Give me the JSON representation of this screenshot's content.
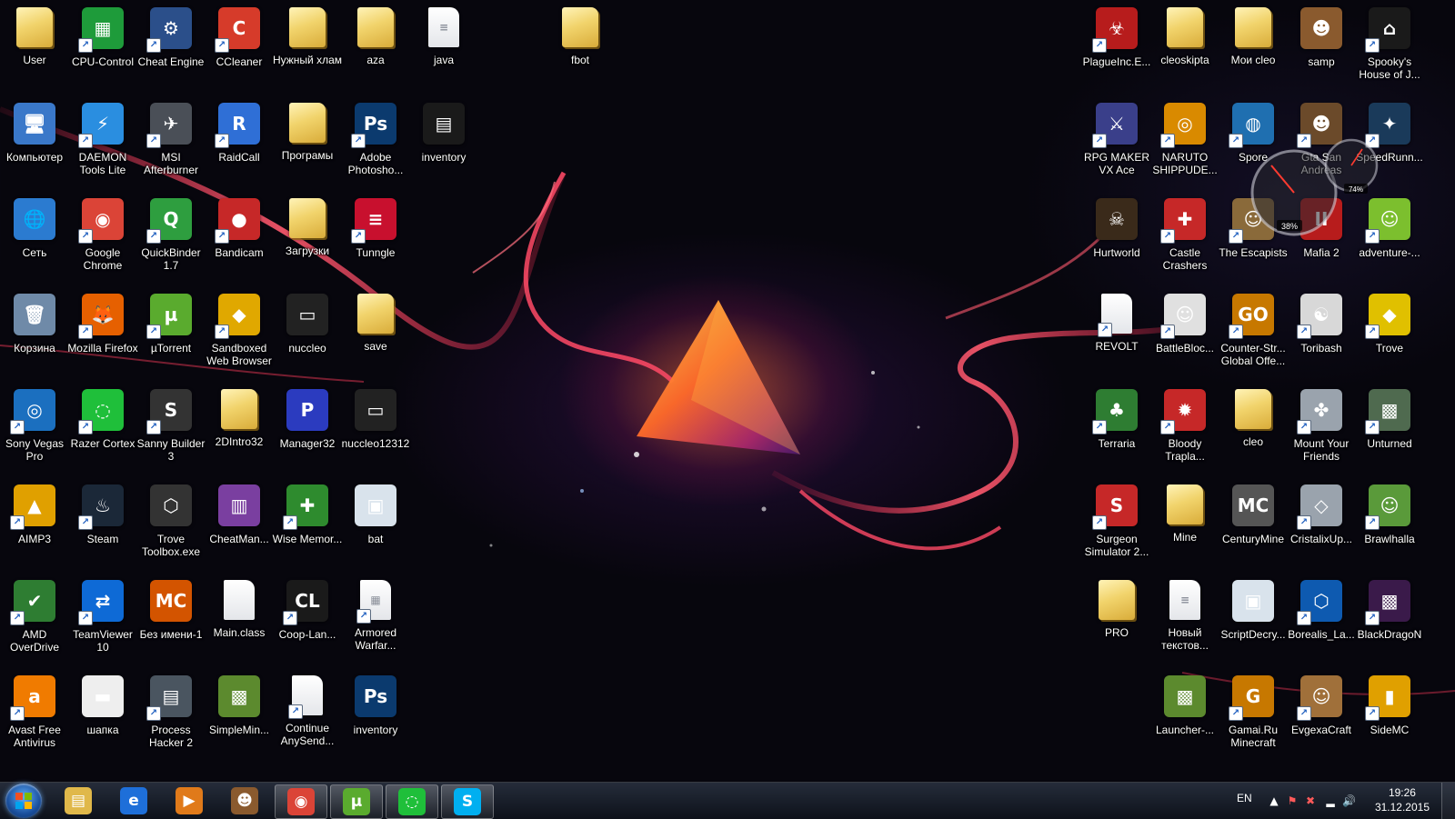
{
  "colors": {
    "label_text": "#ffffff",
    "accent_red": "#ff3b5c",
    "taskbar": "#141a24"
  },
  "desktop_icons": [
    {
      "label": "User",
      "type": "folder",
      "glyph": "",
      "bg": "",
      "shortcut": false,
      "col": 0,
      "row": 0,
      "side": "left"
    },
    {
      "label": "CPU-Control",
      "type": "app",
      "glyph": "▦",
      "bg": "#1e9b3a",
      "shortcut": true,
      "col": 1,
      "row": 0,
      "side": "left"
    },
    {
      "label": "Cheat Engine",
      "type": "app",
      "glyph": "⚙",
      "bg": "#2b4f8a",
      "shortcut": true,
      "col": 2,
      "row": 0,
      "side": "left"
    },
    {
      "label": "CCleaner",
      "type": "app",
      "glyph": "C",
      "bg": "#d63b2a",
      "shortcut": true,
      "col": 3,
      "row": 0,
      "side": "left"
    },
    {
      "label": "Нужный хлам",
      "type": "folder",
      "glyph": "",
      "bg": "",
      "shortcut": false,
      "col": 4,
      "row": 0,
      "side": "left"
    },
    {
      "label": "aza",
      "type": "folder",
      "glyph": "",
      "bg": "",
      "shortcut": false,
      "col": 5,
      "row": 0,
      "side": "left"
    },
    {
      "label": "java",
      "type": "doc",
      "glyph": "≡",
      "bg": "",
      "shortcut": false,
      "col": 6,
      "row": 0,
      "side": "left"
    },
    {
      "label": "fbot",
      "type": "folder",
      "glyph": "",
      "bg": "",
      "shortcut": false,
      "col": 8,
      "row": 0,
      "side": "left"
    },
    {
      "label": "Компьютер",
      "type": "app",
      "glyph": "🖥",
      "bg": "#3a78c9",
      "shortcut": false,
      "col": 0,
      "row": 1,
      "side": "left"
    },
    {
      "label": "DAEMON Tools Lite",
      "type": "app",
      "glyph": "⚡",
      "bg": "#2a8ee0",
      "shortcut": true,
      "col": 1,
      "row": 1,
      "side": "left"
    },
    {
      "label": "MSI Afterburner",
      "type": "app",
      "glyph": "✈",
      "bg": "#4a4f57",
      "shortcut": true,
      "col": 2,
      "row": 1,
      "side": "left"
    },
    {
      "label": "RaidCall",
      "type": "app",
      "glyph": "R",
      "bg": "#2f6fd6",
      "shortcut": true,
      "col": 3,
      "row": 1,
      "side": "left"
    },
    {
      "label": "Програмы",
      "type": "folder",
      "glyph": "",
      "bg": "",
      "shortcut": false,
      "col": 4,
      "row": 1,
      "side": "left"
    },
    {
      "label": "Adobe Photosho...",
      "type": "app",
      "glyph": "Ps",
      "bg": "#0b3a6e",
      "shortcut": true,
      "col": 5,
      "row": 1,
      "side": "left"
    },
    {
      "label": "inventory",
      "type": "app",
      "glyph": "▤",
      "bg": "#1a1a1a",
      "shortcut": false,
      "col": 6,
      "row": 1,
      "side": "left"
    },
    {
      "label": "Сеть",
      "type": "app",
      "glyph": "🌐",
      "bg": "#2b7bd0",
      "shortcut": false,
      "col": 0,
      "row": 2,
      "side": "left"
    },
    {
      "label": "Google Chrome",
      "type": "app",
      "glyph": "◉",
      "bg": "#db4437",
      "shortcut": true,
      "col": 1,
      "row": 2,
      "side": "left"
    },
    {
      "label": "QuickBinder 1.7",
      "type": "app",
      "glyph": "Q",
      "bg": "#2e9e3f",
      "shortcut": true,
      "col": 2,
      "row": 2,
      "side": "left"
    },
    {
      "label": "Bandicam",
      "type": "app",
      "glyph": "●",
      "bg": "#c62828",
      "shortcut": true,
      "col": 3,
      "row": 2,
      "side": "left"
    },
    {
      "label": "Загрузки",
      "type": "folder",
      "glyph": "",
      "bg": "",
      "shortcut": false,
      "col": 4,
      "row": 2,
      "side": "left"
    },
    {
      "label": "Tunngle",
      "type": "app",
      "glyph": "≡",
      "bg": "#c8102e",
      "shortcut": true,
      "col": 5,
      "row": 2,
      "side": "left"
    },
    {
      "label": "Корзина",
      "type": "app",
      "glyph": "🗑",
      "bg": "#6f8aa8",
      "shortcut": false,
      "col": 0,
      "row": 3,
      "side": "left"
    },
    {
      "label": "Mozilla Firefox",
      "type": "app",
      "glyph": "🦊",
      "bg": "#e66000",
      "shortcut": true,
      "col": 1,
      "row": 3,
      "side": "left"
    },
    {
      "label": "µTorrent",
      "type": "app",
      "glyph": "µ",
      "bg": "#5aab2e",
      "shortcut": true,
      "col": 2,
      "row": 3,
      "side": "left"
    },
    {
      "label": "Sandboxed Web Browser",
      "type": "app",
      "glyph": "◆",
      "bg": "#e0a800",
      "shortcut": true,
      "col": 3,
      "row": 3,
      "side": "left"
    },
    {
      "label": "nuccleo",
      "type": "app",
      "glyph": "▭",
      "bg": "#222",
      "shortcut": false,
      "col": 4,
      "row": 3,
      "side": "left"
    },
    {
      "label": "save",
      "type": "folder",
      "glyph": "",
      "bg": "",
      "shortcut": false,
      "col": 5,
      "row": 3,
      "side": "left"
    },
    {
      "label": "Sony Vegas Pro",
      "type": "app",
      "glyph": "◎",
      "bg": "#1b6fbf",
      "shortcut": true,
      "col": 0,
      "row": 4,
      "side": "left"
    },
    {
      "label": "Razer Cortex",
      "type": "app",
      "glyph": "◌",
      "bg": "#1fbf3a",
      "shortcut": true,
      "col": 1,
      "row": 4,
      "side": "left"
    },
    {
      "label": "Sanny Builder 3",
      "type": "app",
      "glyph": "S",
      "bg": "#333",
      "shortcut": true,
      "col": 2,
      "row": 4,
      "side": "left"
    },
    {
      "label": "2DIntro32",
      "type": "folder",
      "glyph": "",
      "bg": "",
      "shortcut": false,
      "col": 3,
      "row": 4,
      "side": "left"
    },
    {
      "label": "Manager32",
      "type": "app",
      "glyph": "P",
      "bg": "#2b3bbf",
      "shortcut": false,
      "col": 4,
      "row": 4,
      "side": "left"
    },
    {
      "label": "nuccleo12312",
      "type": "app",
      "glyph": "▭",
      "bg": "#222",
      "shortcut": false,
      "col": 5,
      "row": 4,
      "side": "left"
    },
    {
      "label": "AIMP3",
      "type": "app",
      "glyph": "▲",
      "bg": "#e0a000",
      "shortcut": true,
      "col": 0,
      "row": 5,
      "side": "left"
    },
    {
      "label": "Steam",
      "type": "app",
      "glyph": "♨",
      "bg": "#1b2838",
      "shortcut": true,
      "col": 1,
      "row": 5,
      "side": "left"
    },
    {
      "label": "Trove Toolbox.exe",
      "type": "app",
      "glyph": "⬡",
      "bg": "#333",
      "shortcut": false,
      "col": 2,
      "row": 5,
      "side": "left"
    },
    {
      "label": "CheatMan...",
      "type": "app",
      "glyph": "▥",
      "bg": "#7a3fa0",
      "shortcut": false,
      "col": 3,
      "row": 5,
      "side": "left"
    },
    {
      "label": "Wise Memor...",
      "type": "app",
      "glyph": "✚",
      "bg": "#2e8b2e",
      "shortcut": true,
      "col": 4,
      "row": 5,
      "side": "left"
    },
    {
      "label": "bat",
      "type": "app",
      "glyph": "▣",
      "bg": "#d9e3ec",
      "shortcut": false,
      "col": 5,
      "row": 5,
      "side": "left"
    },
    {
      "label": "AMD OverDrive",
      "type": "app",
      "glyph": "✔",
      "bg": "#2e7d32",
      "shortcut": true,
      "col": 0,
      "row": 6,
      "side": "left"
    },
    {
      "label": "TeamViewer 10",
      "type": "app",
      "glyph": "⇄",
      "bg": "#0e6ad6",
      "shortcut": true,
      "col": 1,
      "row": 6,
      "side": "left"
    },
    {
      "label": "Без имени-1",
      "type": "app",
      "glyph": "MC",
      "bg": "#d35400",
      "shortcut": false,
      "col": 2,
      "row": 6,
      "side": "left"
    },
    {
      "label": "Main.class",
      "type": "doc",
      "glyph": "",
      "bg": "",
      "shortcut": false,
      "col": 3,
      "row": 6,
      "side": "left"
    },
    {
      "label": "Coop-Lan...",
      "type": "app",
      "glyph": "CL",
      "bg": "#1a1a1a",
      "shortcut": true,
      "col": 4,
      "row": 6,
      "side": "left"
    },
    {
      "label": "Armored Warfar...",
      "type": "doc",
      "glyph": "▦",
      "bg": "",
      "shortcut": true,
      "col": 5,
      "row": 6,
      "side": "left"
    },
    {
      "label": "Avast Free Antivirus",
      "type": "app",
      "glyph": "a",
      "bg": "#f07b00",
      "shortcut": true,
      "col": 0,
      "row": 7,
      "side": "left"
    },
    {
      "label": "шапка",
      "type": "app",
      "glyph": "▬",
      "bg": "#eeeeee",
      "shortcut": false,
      "col": 1,
      "row": 7,
      "side": "left"
    },
    {
      "label": "Process Hacker 2",
      "type": "app",
      "glyph": "▤",
      "bg": "#4a5560",
      "shortcut": true,
      "col": 2,
      "row": 7,
      "side": "left"
    },
    {
      "label": "SimpleMin...",
      "type": "app",
      "glyph": "▩",
      "bg": "#5c8a2e",
      "shortcut": false,
      "col": 3,
      "row": 7,
      "side": "left"
    },
    {
      "label": "Continue AnySend...",
      "type": "doc",
      "glyph": "",
      "bg": "",
      "shortcut": true,
      "col": 4,
      "row": 7,
      "side": "left"
    },
    {
      "label": "inventory",
      "type": "app",
      "glyph": "Ps",
      "bg": "#0b3a6e",
      "shortcut": false,
      "col": 5,
      "row": 7,
      "side": "left"
    },
    {
      "label": "PlagueInc.E...",
      "type": "app",
      "glyph": "☣",
      "bg": "#b71c1c",
      "shortcut": true,
      "col": 0,
      "row": 0,
      "side": "right"
    },
    {
      "label": "cleoskipta",
      "type": "folder",
      "glyph": "",
      "bg": "",
      "shortcut": false,
      "col": 1,
      "row": 0,
      "side": "right"
    },
    {
      "label": "Мои cleo",
      "type": "folder",
      "glyph": "",
      "bg": "",
      "shortcut": false,
      "col": 2,
      "row": 0,
      "side": "right"
    },
    {
      "label": "samp",
      "type": "app",
      "glyph": "☻",
      "bg": "#8a5a2e",
      "shortcut": false,
      "col": 3,
      "row": 0,
      "side": "right"
    },
    {
      "label": "Spooky's House of J...",
      "type": "app",
      "glyph": "⌂",
      "bg": "#1a1a1a",
      "shortcut": true,
      "col": 4,
      "row": 0,
      "side": "right"
    },
    {
      "label": "RPG MAKER VX Ace",
      "type": "app",
      "glyph": "⚔",
      "bg": "#3a3f8a",
      "shortcut": true,
      "col": 0,
      "row": 1,
      "side": "right"
    },
    {
      "label": "NARUTO SHIPPUDE...",
      "type": "app",
      "glyph": "◎",
      "bg": "#d98a00",
      "shortcut": true,
      "col": 1,
      "row": 1,
      "side": "right"
    },
    {
      "label": "Spore",
      "type": "app",
      "glyph": "◍",
      "bg": "#1f6fb0",
      "shortcut": true,
      "col": 2,
      "row": 1,
      "side": "right"
    },
    {
      "label": "Gta San Andreas",
      "type": "app",
      "glyph": "☻",
      "bg": "#6b4a2a",
      "shortcut": true,
      "col": 3,
      "row": 1,
      "side": "right"
    },
    {
      "label": "SpeedRunn...",
      "type": "app",
      "glyph": "✦",
      "bg": "#1a3a5a",
      "shortcut": true,
      "col": 4,
      "row": 1,
      "side": "right"
    },
    {
      "label": "Hurtworld",
      "type": "app",
      "glyph": "☠",
      "bg": "#3a2a1a",
      "shortcut": false,
      "col": 0,
      "row": 2,
      "side": "right"
    },
    {
      "label": "Castle Crashers",
      "type": "app",
      "glyph": "✚",
      "bg": "#c62828",
      "shortcut": true,
      "col": 1,
      "row": 2,
      "side": "right"
    },
    {
      "label": "The Escapists",
      "type": "app",
      "glyph": "☺",
      "bg": "#8a6a3a",
      "shortcut": true,
      "col": 2,
      "row": 2,
      "side": "right"
    },
    {
      "label": "Mafia 2",
      "type": "app",
      "glyph": "II",
      "bg": "#b71c1c",
      "shortcut": false,
      "col": 3,
      "row": 2,
      "side": "right"
    },
    {
      "label": "adventure-...",
      "type": "app",
      "glyph": "☺",
      "bg": "#7cbf2e",
      "shortcut": true,
      "col": 4,
      "row": 2,
      "side": "right"
    },
    {
      "label": "REVOLT",
      "type": "doc",
      "glyph": "",
      "bg": "",
      "shortcut": true,
      "col": 0,
      "row": 3,
      "side": "right"
    },
    {
      "label": "BattleBloc...",
      "type": "app",
      "glyph": "☺",
      "bg": "#e0e0e0",
      "shortcut": true,
      "col": 1,
      "row": 3,
      "side": "right"
    },
    {
      "label": "Counter-Str... Global Offe...",
      "type": "app",
      "glyph": "GO",
      "bg": "#c77800",
      "shortcut": true,
      "col": 2,
      "row": 3,
      "side": "right"
    },
    {
      "label": "Toribash",
      "type": "app",
      "glyph": "☯",
      "bg": "#d8d8d8",
      "shortcut": true,
      "col": 3,
      "row": 3,
      "side": "right"
    },
    {
      "label": "Trove",
      "type": "app",
      "glyph": "◆",
      "bg": "#e0c000",
      "shortcut": true,
      "col": 4,
      "row": 3,
      "side": "right"
    },
    {
      "label": "Terraria",
      "type": "app",
      "glyph": "♣",
      "bg": "#2e7d32",
      "shortcut": true,
      "col": 0,
      "row": 4,
      "side": "right"
    },
    {
      "label": "Bloody Trapla...",
      "type": "app",
      "glyph": "✹",
      "bg": "#c62828",
      "shortcut": true,
      "col": 1,
      "row": 4,
      "side": "right"
    },
    {
      "label": "cleo",
      "type": "folder",
      "glyph": "",
      "bg": "",
      "shortcut": false,
      "col": 2,
      "row": 4,
      "side": "right"
    },
    {
      "label": "Mount Your Friends",
      "type": "app",
      "glyph": "✤",
      "bg": "#9aa3ad",
      "shortcut": true,
      "col": 3,
      "row": 4,
      "side": "right"
    },
    {
      "label": "Unturned",
      "type": "app",
      "glyph": "▩",
      "bg": "#4f6a4f",
      "shortcut": true,
      "col": 4,
      "row": 4,
      "side": "right"
    },
    {
      "label": "Surgeon Simulator 2...",
      "type": "app",
      "glyph": "S",
      "bg": "#c62828",
      "shortcut": true,
      "col": 0,
      "row": 5,
      "side": "right"
    },
    {
      "label": "Mine",
      "type": "folder",
      "glyph": "",
      "bg": "",
      "shortcut": false,
      "col": 1,
      "row": 5,
      "side": "right"
    },
    {
      "label": "CenturyMine",
      "type": "app",
      "glyph": "MC",
      "bg": "#555",
      "shortcut": false,
      "col": 2,
      "row": 5,
      "side": "right"
    },
    {
      "label": "CristalixUp...",
      "type": "app",
      "glyph": "◇",
      "bg": "#9aa3ad",
      "shortcut": true,
      "col": 3,
      "row": 5,
      "side": "right"
    },
    {
      "label": "Brawlhalla",
      "type": "app",
      "glyph": "☺",
      "bg": "#5a9a3a",
      "shortcut": true,
      "col": 4,
      "row": 5,
      "side": "right"
    },
    {
      "label": "PRO",
      "type": "folder",
      "glyph": "",
      "bg": "",
      "shortcut": false,
      "col": 0,
      "row": 6,
      "side": "right"
    },
    {
      "label": "Новый текстов...",
      "type": "doc",
      "glyph": "≡",
      "bg": "",
      "shortcut": false,
      "col": 1,
      "row": 6,
      "side": "right"
    },
    {
      "label": "ScriptDecry...",
      "type": "app",
      "glyph": "▣",
      "bg": "#d9e3ec",
      "shortcut": false,
      "col": 2,
      "row": 6,
      "side": "right"
    },
    {
      "label": "Borealis_La...",
      "type": "app",
      "glyph": "⬡",
      "bg": "#0e5ab0",
      "shortcut": true,
      "col": 3,
      "row": 6,
      "side": "right"
    },
    {
      "label": "BlackDragoN",
      "type": "app",
      "glyph": "▩",
      "bg": "#3a1a4a",
      "shortcut": true,
      "col": 4,
      "row": 6,
      "side": "right"
    },
    {
      "label": "Launcher-...",
      "type": "app",
      "glyph": "▩",
      "bg": "#5c8a2e",
      "shortcut": false,
      "col": 1,
      "row": 7,
      "side": "right"
    },
    {
      "label": "Gamai.Ru Minecraft",
      "type": "app",
      "glyph": "G",
      "bg": "#c77800",
      "shortcut": true,
      "col": 2,
      "row": 7,
      "side": "right"
    },
    {
      "label": "EvgexaCraft",
      "type": "app",
      "glyph": "☺",
      "bg": "#a0703a",
      "shortcut": true,
      "col": 3,
      "row": 7,
      "side": "right"
    },
    {
      "label": "SideMC",
      "type": "app",
      "glyph": "▮",
      "bg": "#e0a000",
      "shortcut": true,
      "col": 4,
      "row": 7,
      "side": "right"
    }
  ],
  "gadget": {
    "cpu_percent_text": "38%",
    "mem_percent_text": "74%"
  },
  "taskbar": {
    "pinned": [
      {
        "name": "explorer",
        "glyph": "▤",
        "bg": "#e0b84a",
        "active": false
      },
      {
        "name": "internet-explorer",
        "glyph": "e",
        "bg": "#1e6fd9",
        "active": false
      },
      {
        "name": "media-player",
        "glyph": "▶",
        "bg": "#e07a1a",
        "active": false
      },
      {
        "name": "samp",
        "glyph": "☻",
        "bg": "#8a5a2e",
        "active": false
      },
      {
        "name": "chrome",
        "glyph": "◉",
        "bg": "#db4437",
        "active": true
      },
      {
        "name": "utorrent",
        "glyph": "µ",
        "bg": "#5aab2e",
        "active": true
      },
      {
        "name": "razer-cortex",
        "glyph": "◌",
        "bg": "#1fbf3a",
        "active": true
      },
      {
        "name": "skype",
        "glyph": "S",
        "bg": "#00aff0",
        "active": true
      }
    ]
  },
  "tray": {
    "language": "EN",
    "time": "19:26",
    "date": "31.12.2015"
  }
}
